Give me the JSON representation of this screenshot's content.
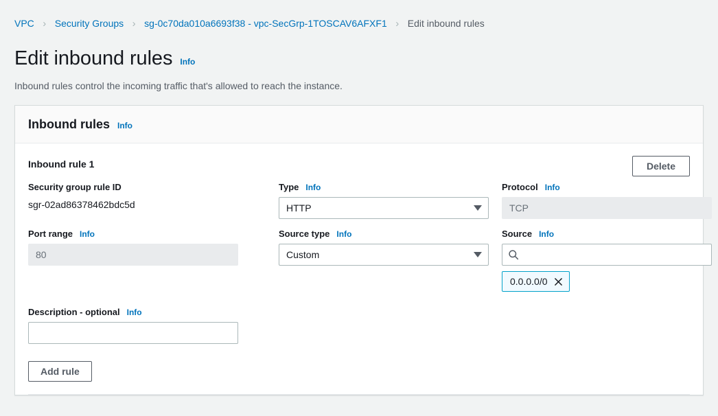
{
  "breadcrumb": {
    "items": [
      {
        "label": "VPC",
        "current": false
      },
      {
        "label": "Security Groups",
        "current": false
      },
      {
        "label": "sg-0c70da010a6693f38 - vpc-SecGrp-1TOSCAV6AFXF1",
        "current": false
      },
      {
        "label": "Edit inbound rules",
        "current": true
      }
    ],
    "separator": "›"
  },
  "page": {
    "title": "Edit inbound rules",
    "title_info": "Info",
    "description": "Inbound rules control the incoming traffic that's allowed to reach the instance."
  },
  "card": {
    "header_title": "Inbound rules",
    "header_info": "Info"
  },
  "rule": {
    "title": "Inbound rule 1",
    "delete_label": "Delete",
    "rule_id_label": "Security group rule ID",
    "rule_id_value": "sgr-02ad86378462bdc5d",
    "port_range_label": "Port range",
    "port_range_info": "Info",
    "port_range_value": "80",
    "type_label": "Type",
    "type_info": "Info",
    "type_value": "HTTP",
    "source_type_label": "Source type",
    "source_type_info": "Info",
    "source_type_value": "Custom",
    "protocol_label": "Protocol",
    "protocol_info": "Info",
    "protocol_value": "TCP",
    "source_label": "Source",
    "source_info": "Info",
    "source_search_placeholder": "",
    "source_token": "0.0.0.0/0",
    "description_label": "Description - optional",
    "description_info": "Info",
    "description_value": ""
  },
  "actions": {
    "add_rule_label": "Add rule"
  },
  "icons": {
    "search": "search-icon",
    "close": "close-icon",
    "chevron_down": "chevron-down-icon"
  },
  "colors": {
    "link": "#0073bb",
    "page_bg": "#f1f3f3",
    "card_bg": "#ffffff",
    "border": "#d5dbdb",
    "disabled_bg": "#e9ebed",
    "token_border": "#00a1c9",
    "token_bg": "#f1faff",
    "text": "#16191f",
    "muted_text": "#545b64"
  }
}
